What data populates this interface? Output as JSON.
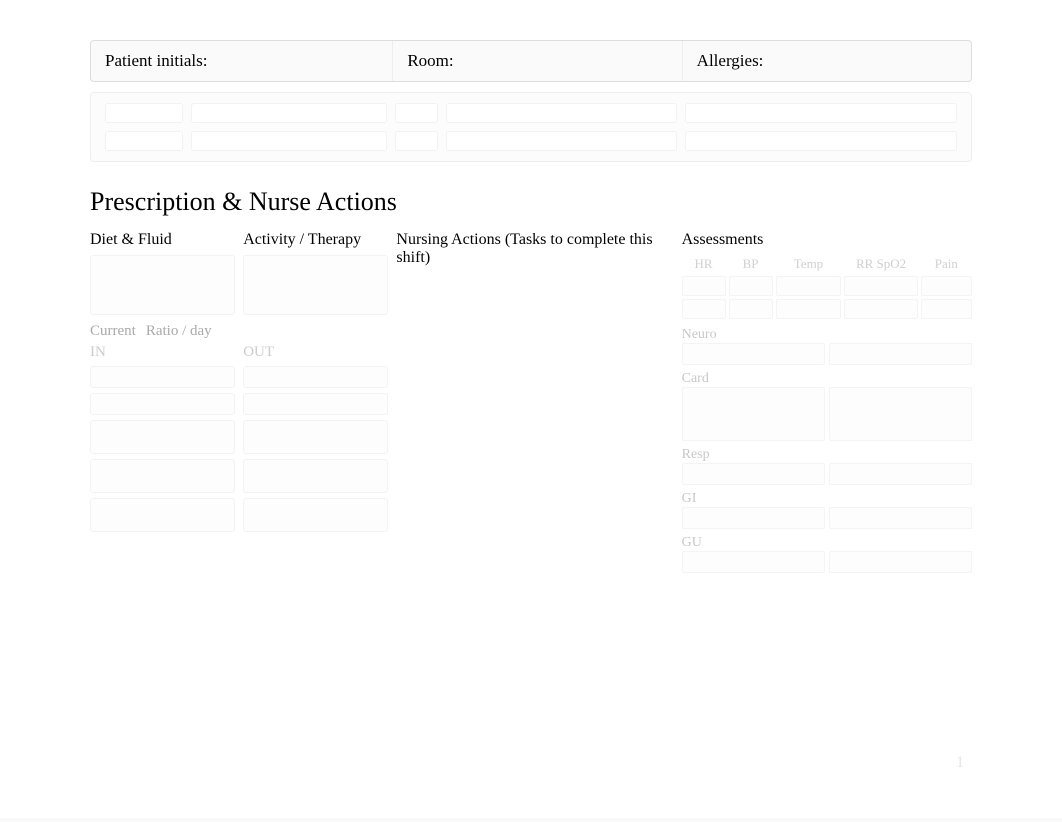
{
  "header": {
    "patient_initials_label": "Patient initials:",
    "room_label": "Room:",
    "allergies_label": "Allergies:"
  },
  "section": {
    "title": "Prescription & Nurse Actions"
  },
  "columns": {
    "diet_head": "Diet & Fluid",
    "activity_head": "Activity / Therapy",
    "nursing_head": "Nursing Actions (Tasks to complete this shift)",
    "assess_head": "Assessments"
  },
  "diet_inline": {
    "current": "Current",
    "ratio": "Ratio / day"
  },
  "diet_subs": {
    "in": "IN",
    "out": "OUT"
  },
  "vitals": {
    "hr": "HR",
    "bp": "BP",
    "temp": "Temp",
    "rr_spo2": "RR SpO2",
    "pain": "Pain"
  },
  "assess_rows": {
    "neuro": "Neuro",
    "card": "Card",
    "resp": "Resp",
    "gi": "GI",
    "gu": "GU"
  },
  "page_number": "1"
}
